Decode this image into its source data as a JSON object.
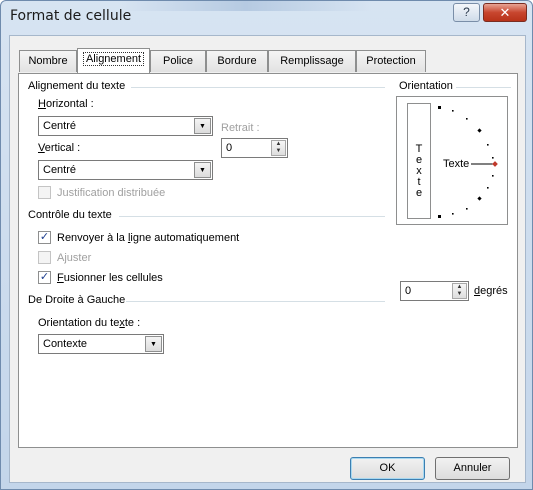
{
  "window": {
    "title": "Format de cellule",
    "help_label": "?",
    "close_label": "✕"
  },
  "tabs": [
    {
      "label": "Nombre"
    },
    {
      "label": "Alignement"
    },
    {
      "label": "Police"
    },
    {
      "label": "Bordure"
    },
    {
      "label": "Remplissage"
    },
    {
      "label": "Protection"
    }
  ],
  "active_tab": "Alignement",
  "text_alignment": {
    "title": "Alignement du texte",
    "horizontal_label_u": "H",
    "horizontal_label_rest": "orizontal :",
    "horizontal_value": "Centré",
    "indent_label": "Retrait :",
    "indent_value": "0",
    "vertical_label_u": "V",
    "vertical_label_rest": "ertical :",
    "vertical_value": "Centré",
    "distributed_label": "Justification distribuée",
    "distributed_checked": false
  },
  "text_control": {
    "title": "Contrôle du texte",
    "wrap_pre": "Renvoyer à la ",
    "wrap_u": "l",
    "wrap_post": "igne automatiquement",
    "wrap_checked": true,
    "shrink_label": "Ajuster",
    "shrink_checked": false,
    "merge_u": "F",
    "merge_post": "usionner les cellules",
    "merge_checked": true
  },
  "rtl": {
    "title": "De Droite à Gauche",
    "direction_pre": "Orientation du te",
    "direction_u": "x",
    "direction_post": "te :",
    "direction_value": "Contexte"
  },
  "orientation": {
    "title": "Orientation",
    "vertical_letters": [
      "T",
      "e",
      "x",
      "t",
      "e"
    ],
    "dial_text": "Texte",
    "degrees_value": "0",
    "degrees_u": "d",
    "degrees_rest": "egrés",
    "accent_color": "#c0392b"
  },
  "buttons": {
    "ok": "OK",
    "cancel": "Annuler"
  }
}
